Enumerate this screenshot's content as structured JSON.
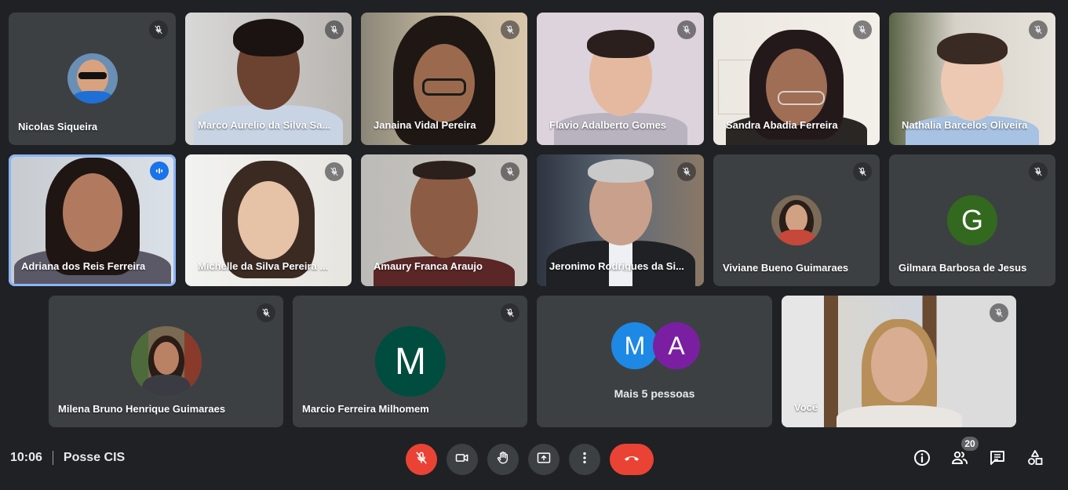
{
  "meeting": {
    "time": "10:06",
    "title": "Posse CIS"
  },
  "colors": {
    "bg": "#202124",
    "tile": "#3c4043",
    "red": "#ea4335",
    "speaking": "#8ab4f8"
  },
  "participants": [
    {
      "name": "Nicolas Siqueira"
    },
    {
      "name": "Marco Aurelio da Silva Sa..."
    },
    {
      "name": "Janaina Vidal Pereira"
    },
    {
      "name": "Flavio Adalberto Gomes"
    },
    {
      "name": "Sandra Abadia Ferreira"
    },
    {
      "name": "Nathalia Barcelos Oliveira"
    },
    {
      "name": "Adriana dos Reis Ferreira"
    },
    {
      "name": "Michelle da Silva Pereira ..."
    },
    {
      "name": "Amaury Franca Araujo"
    },
    {
      "name": "Jeronimo Rodrigues da Si..."
    },
    {
      "name": "Viviane Bueno Guimaraes"
    },
    {
      "name": "Gilmara Barbosa de Jesus",
      "initial": "G"
    },
    {
      "name": "Milena Bruno Henrique Guimaraes"
    },
    {
      "name": "Marcio Ferreira Milhomem",
      "initial": "M"
    },
    {
      "name": "Você"
    }
  ],
  "others": {
    "label": "Mais 5 pessoas",
    "initials": [
      "M",
      "A"
    ]
  },
  "people_count": "20",
  "icons": [
    "mic-off-icon",
    "camera-icon",
    "raise-hand-icon",
    "present-icon",
    "more-icon",
    "end-call-icon",
    "info-icon",
    "people-icon",
    "chat-icon",
    "activities-icon",
    "speaking-icon"
  ]
}
